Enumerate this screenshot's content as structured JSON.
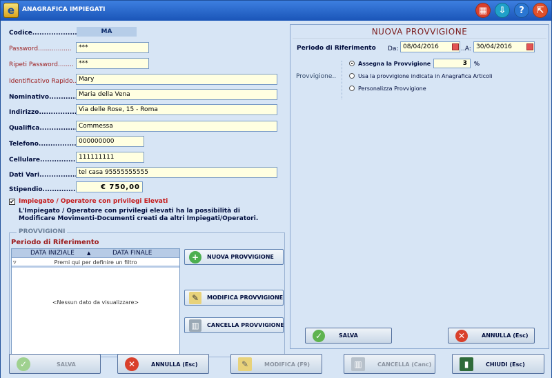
{
  "window": {
    "title": "ANAGRAFICA IMPIEGATI",
    "app_icon": "e"
  },
  "titlebar_buttons": [
    {
      "icon": "calculator-icon",
      "glyph": "▦",
      "color": "#d9402b"
    },
    {
      "icon": "download-icon",
      "glyph": "⇩",
      "color": "#1fa0c9"
    },
    {
      "icon": "help-icon",
      "glyph": "?",
      "color": "#2a76d2"
    },
    {
      "icon": "exit-icon",
      "glyph": "⇱",
      "color": "#e0502b"
    }
  ],
  "form": {
    "codice_label": "Codice.......................",
    "codice_value": "MA",
    "password_label": "Password.................",
    "password_value": "***",
    "ripeti_label": "Ripeti Password........",
    "ripeti_value": "***",
    "identificativo_label": "Identificativo Rapido..",
    "identificativo_value": "Mary",
    "nominativo_label": "Nominativo...................",
    "nominativo_value": "Maria della Vena",
    "indirizzo_label": "Indirizzo.......................",
    "indirizzo_value": "Via delle Rose, 15 - Roma",
    "qualifica_label": "Qualifica........................",
    "qualifica_value": "Commessa",
    "telefono_label": "Telefono.........................",
    "telefono_value": "000000000",
    "cellulare_label": "Cellulare........................",
    "cellulare_value": "111111111",
    "dati_vari_label": "Dati Vari...........................",
    "dati_vari_value": "tel casa 95555555555",
    "stipendio_label": "Stipendio.......................",
    "stipendio_value": "€ 750,00",
    "privilegi_checked": "✔",
    "privilegi_label": "Impiegato / Operatore con privilegi Elevati",
    "privilegi_info": "L'Impiegato / Operatore con privilegi elevati ha la possibilità di Modificare Movimenti-Documenti creati da altri Impiegati/Operatori."
  },
  "provvigioni": {
    "box_title": "PROVVIGIONI",
    "periodo_label": "Periodo di Riferimento",
    "col_inizio": "DATA INIZIALE",
    "col_fine": "DATA FINALE",
    "sort_glyph": "▲",
    "filter_glyph": "▿",
    "filter_hint": "Premi qui per definire un filtro",
    "empty_text": "<Nessun dato da visualizzare>",
    "btn_nuova": "NUOVA PROVVIGIONE",
    "btn_modifica": "MODIFICA PROVVIGIONE",
    "btn_cancella": "CANCELLA PROVVIGIONE"
  },
  "nuova": {
    "title": "NUOVA PROVVIGIONE",
    "periodo_label": "Periodo di Riferimento",
    "da_label": "Da:",
    "da_value": "08/04/2016",
    "a_label": "..A:",
    "a_value": "30/04/2016",
    "provvigione_label": "Provvigione..",
    "opt_assegna": "Assegna la Provvigione",
    "assegna_value": "3",
    "percent": "%",
    "opt_usa": "Usa la provvigione indicata in Anagrafica Articoli",
    "opt_personalizza": "Personalizza Provvigione",
    "btn_salva": "SALVA",
    "btn_annulla": "ANNULLA (Esc)"
  },
  "footer": {
    "salva": "SALVA",
    "annulla": "ANNULLA (Esc)",
    "modifica": "MODIFICA (F9)",
    "cancella": "CANCELLA (Canc)",
    "chiudi": "CHIUDI (Esc)"
  },
  "colors": {
    "accent": "#1a55b8",
    "label_red": "#9c1c1c",
    "field_bg": "#ffffe1",
    "panel_bg": "#d7e5f5"
  }
}
